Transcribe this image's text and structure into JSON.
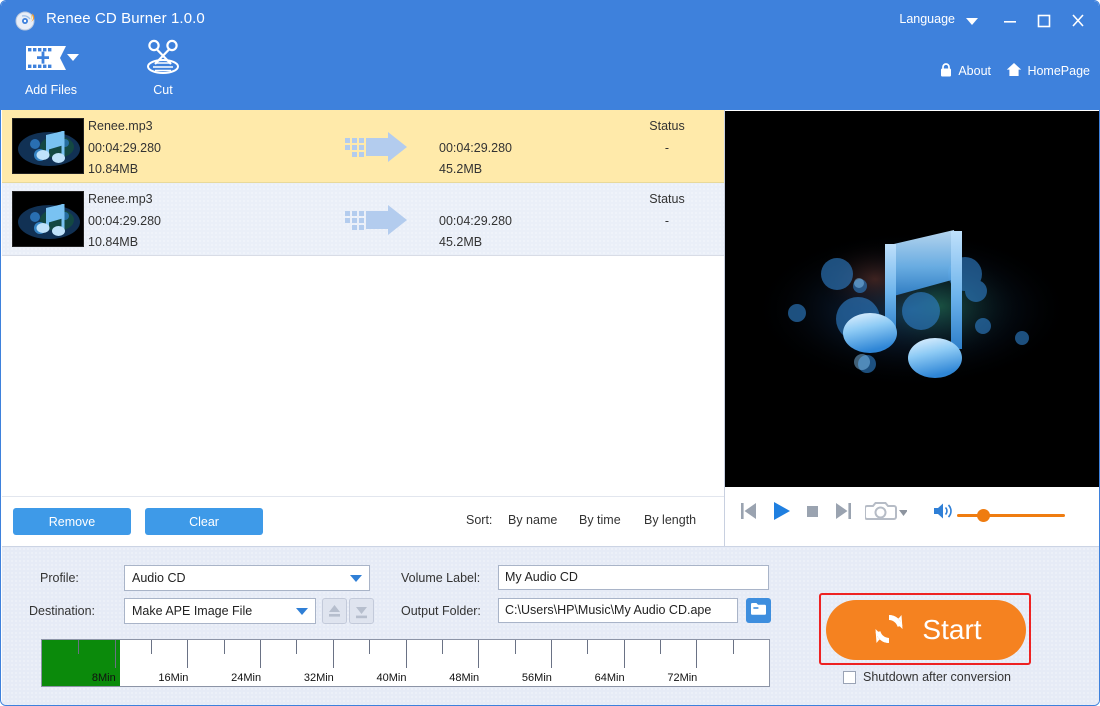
{
  "window": {
    "title": "Renee CD Burner 1.0.0",
    "logo_icon": "cd-burn-icon",
    "language_label": "Language",
    "language_caret_icon": "chevron-down-icon",
    "minimize_icon": "minimize-icon",
    "maximize_icon": "maximize-icon",
    "close_icon": "close-icon",
    "header_color": "#3e81dc"
  },
  "toolbar": {
    "add_files_label": "Add Files",
    "add_files_icon": "add-film-icon",
    "add_files_caret_icon": "chevron-down-icon",
    "cut_label": "Cut",
    "cut_icon": "scissors-icon"
  },
  "header_links": {
    "about_label": "About",
    "about_icon": "lock-icon",
    "homepage_label": "HomePage",
    "homepage_icon": "home-icon"
  },
  "file_list": {
    "status_header": "Status",
    "arrow_icon": "convert-arrow-icon",
    "thumbnail_icon": "music-note-thumbnail",
    "rows": [
      {
        "name": "Renee.mp3",
        "duration": "00:04:29.280",
        "size": "10.84MB",
        "out_duration": "00:04:29.280",
        "out_size": "45.2MB",
        "status_header": "Status",
        "status": "-",
        "selected": true
      },
      {
        "name": "Renee.mp3",
        "duration": "00:04:29.280",
        "size": "10.84MB",
        "out_duration": "00:04:29.280",
        "out_size": "45.2MB",
        "status_header": "Status",
        "status": "-",
        "selected": false
      }
    ]
  },
  "list_toolbar": {
    "remove_label": "Remove",
    "clear_label": "Clear",
    "sort_label": "Sort:",
    "sort_by_name": "By name",
    "sort_by_time": "By time",
    "sort_by_length": "By length"
  },
  "player": {
    "prev_icon": "skip-previous-icon",
    "play_icon": "play-icon",
    "stop_icon": "stop-icon",
    "next_icon": "skip-next-icon",
    "snapshot_icon": "camera-icon",
    "snapshot_caret_icon": "chevron-down-icon",
    "volume_icon": "speaker-icon",
    "volume_color": "#ef7c10"
  },
  "preview": {
    "artwork_icon": "music-note-artwork",
    "background": "#000000"
  },
  "settings": {
    "profile_label": "Profile:",
    "profile_value": "Audio CD",
    "destination_label": "Destination:",
    "destination_value": "Make APE Image File",
    "eject_icon": "eject-up-icon",
    "load_icon": "eject-down-icon",
    "volume_label_label": "Volume Label:",
    "volume_label_value": "My Audio CD",
    "output_folder_label": "Output Folder:",
    "output_folder_value": "C:\\Users\\HP\\Music\\My Audio CD.ape",
    "browse_icon": "folder-icon"
  },
  "capacity": {
    "fill_color": "#0b8a0b",
    "fill_minutes": 8.6,
    "max_minutes": 80,
    "ticks": [
      {
        "minutes": 8,
        "label": "8Min"
      },
      {
        "minutes": 16,
        "label": "16Min"
      },
      {
        "minutes": 24,
        "label": "24Min"
      },
      {
        "minutes": 32,
        "label": "32Min"
      },
      {
        "minutes": 40,
        "label": "40Min"
      },
      {
        "minutes": 48,
        "label": "48Min"
      },
      {
        "minutes": 56,
        "label": "56Min"
      },
      {
        "minutes": 64,
        "label": "64Min"
      },
      {
        "minutes": 72,
        "label": "72Min"
      }
    ],
    "minor_ticks": [
      4,
      12,
      20,
      28,
      36,
      44,
      52,
      60,
      68,
      76
    ]
  },
  "action": {
    "start_label": "Start",
    "start_icon": "refresh-circle-icon",
    "start_color": "#f58220",
    "highlight_color": "#ee2222",
    "shutdown_label": "Shutdown after conversion",
    "shutdown_checked": false
  }
}
